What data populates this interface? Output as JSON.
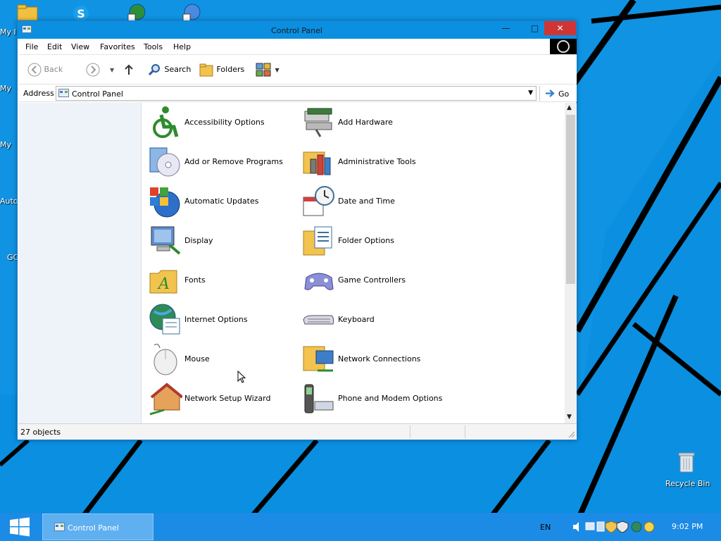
{
  "desktop": {
    "icons": [
      {
        "label": "My I",
        "icon": "my-documents-icon"
      },
      {
        "label": "My",
        "icon": "my-computer-icon"
      },
      {
        "label": "My",
        "icon": "my-network-icon"
      },
      {
        "label": "Auto",
        "icon": "autorun-icon"
      },
      {
        "label": "GC",
        "icon": "gc-icon"
      }
    ],
    "top_icons": [
      "folder-icon",
      "skype-icon",
      "globe-arrow-icon",
      "globe-shortcut-icon"
    ],
    "recycle_bin": {
      "label": "Recycle Bin",
      "icon": "recycle-bin-icon"
    }
  },
  "window": {
    "title": "Control Panel",
    "menu": [
      "File",
      "Edit",
      "View",
      "Favorites",
      "Tools",
      "Help"
    ],
    "toolbar": {
      "back": "Back",
      "search": "Search",
      "folders": "Folders"
    },
    "address": {
      "label": "Address",
      "value": "Control Panel",
      "go": "Go"
    },
    "items": [
      {
        "label": "Accessibility Options",
        "icon": "accessibility-icon"
      },
      {
        "label": "Add Hardware",
        "icon": "add-hardware-icon"
      },
      {
        "label": "Add or Remove Programs",
        "icon": "add-remove-programs-icon"
      },
      {
        "label": "Administrative Tools",
        "icon": "administrative-tools-icon"
      },
      {
        "label": "Automatic Updates",
        "icon": "automatic-updates-icon"
      },
      {
        "label": "Date and Time",
        "icon": "date-time-icon"
      },
      {
        "label": "Display",
        "icon": "display-icon"
      },
      {
        "label": "Folder Options",
        "icon": "folder-options-icon"
      },
      {
        "label": "Fonts",
        "icon": "fonts-icon"
      },
      {
        "label": "Game Controllers",
        "icon": "game-controllers-icon"
      },
      {
        "label": "Internet Options",
        "icon": "internet-options-icon"
      },
      {
        "label": "Keyboard",
        "icon": "keyboard-icon"
      },
      {
        "label": "Mouse",
        "icon": "mouse-icon"
      },
      {
        "label": "Network Connections",
        "icon": "network-connections-icon"
      },
      {
        "label": "Network Setup Wizard",
        "icon": "network-setup-wizard-icon"
      },
      {
        "label": "Phone and Modem Options",
        "icon": "phone-modem-icon"
      }
    ],
    "status": "27 objects"
  },
  "taskbar": {
    "task_label": "Control Panel",
    "language": "EN",
    "clock": "9:02 PM"
  },
  "colors": {
    "desktop": "#0b8fe0",
    "titlebar": "#0b8fe0",
    "close": "#d13434",
    "taskbar": "#1c8be6"
  }
}
